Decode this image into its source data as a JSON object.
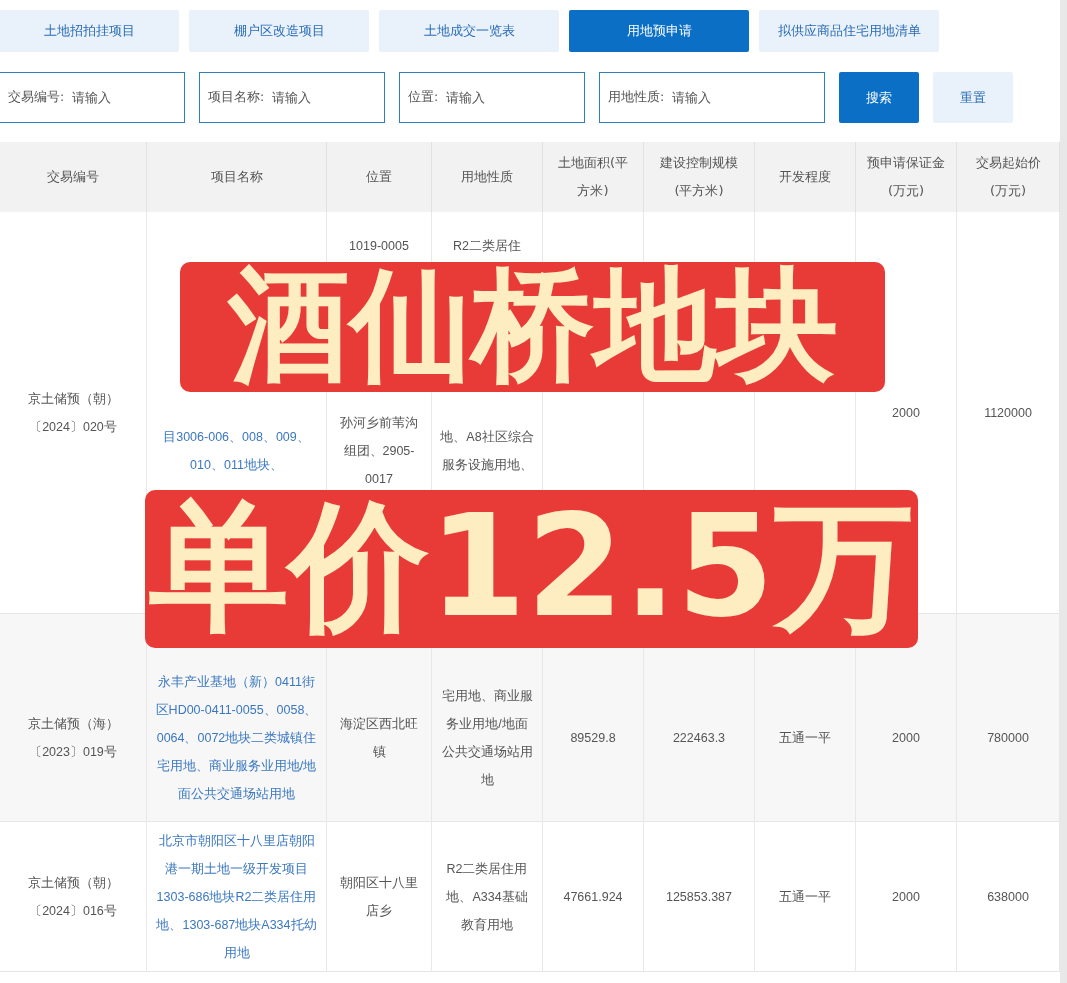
{
  "tabs": [
    {
      "label": "土地招拍挂项目",
      "selected": false
    },
    {
      "label": "棚户区改造项目",
      "selected": false
    },
    {
      "label": "土地成交一览表",
      "selected": false
    },
    {
      "label": "用地预申请",
      "selected": true
    },
    {
      "label": "拟供应商品住宅用地清单",
      "selected": false
    }
  ],
  "filters": [
    {
      "label": "交易编号:",
      "placeholder": "请输入"
    },
    {
      "label": "项目名称:",
      "placeholder": "请输入"
    },
    {
      "label": "位置:",
      "placeholder": "请输入"
    },
    {
      "label": "用地性质:",
      "placeholder": "请输入"
    }
  ],
  "buttons": [
    {
      "label": "搜索",
      "kind": "primary"
    },
    {
      "label": "重置",
      "kind": "secondary"
    }
  ],
  "table": {
    "columns": [
      "交易编号",
      "项目名称",
      "位置",
      "用地性质",
      "土地面积(平方米)",
      "建设控制规模(平方米)",
      "开发程度",
      "预申请保证金(万元)",
      "交易起始价(万元)"
    ],
    "rows": [
      {
        "cells": [
          {
            "text": "京土储预（朝）〔2024〕020号"
          },
          {
            "middle": "目3006-006、008、009、010、011地块、",
            "kind": "link"
          },
          {
            "top": "1019-0005",
            "middle": "孙河乡前苇沟组团、2905-0017"
          },
          {
            "top": "R2二类居住",
            "middle": "地、A8社区综合服务设施用地、"
          },
          {},
          {},
          {},
          {
            "text": "2000"
          },
          {
            "text": "1120000"
          }
        ]
      },
      {
        "cells": [
          {
            "text": "京土储预（海）〔2023〕019号"
          },
          {
            "text": "永丰产业基地（新）0411街区HD00-0411-0055、0058、0064、0072地块二类城镇住宅用地、商业服务业用地/地面公共交通场站用地",
            "kind": "link"
          },
          {
            "text": "海淀区西北旺镇"
          },
          {
            "text": "宅用地、商业服务业用地/地面公共交通场站用地"
          },
          {
            "text": "89529.8"
          },
          {
            "text": "222463.3"
          },
          {
            "text": "五通一平"
          },
          {
            "text": "2000"
          },
          {
            "text": "780000"
          }
        ]
      },
      {
        "cells": [
          {
            "text": "京土储预（朝）〔2024〕016号"
          },
          {
            "text": "北京市朝阳区十八里店朝阳港一期土地一级开发项目1303-686地块R2二类居住用地、1303-687地块A334托幼用地",
            "kind": "link"
          },
          {
            "text": "朝阳区十八里店乡"
          },
          {
            "text": "R2二类居住用地、A334基础教育用地"
          },
          {
            "text": "47661.924"
          },
          {
            "text": "125853.387"
          },
          {
            "text": "五通一平"
          },
          {
            "text": "2000"
          },
          {
            "text": "638000"
          }
        ]
      }
    ]
  },
  "overlay": [
    {
      "text": "酒仙桥地块"
    },
    {
      "text": "单价12.5万"
    }
  ]
}
